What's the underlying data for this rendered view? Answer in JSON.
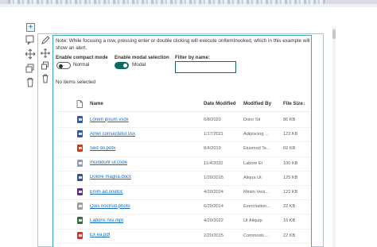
{
  "note": "Note: While focusing a row, pressing enter or double clicking will execute onItemInvoked, which in this example will show an alert.",
  "controls": {
    "compact_label": "Enable compact mode",
    "compact_value": "Normal",
    "modal_label": "Enable modal selection",
    "modal_value": "Modal",
    "filter_label": "Filter by name:",
    "filter_value": ""
  },
  "selection_text": "No items selected",
  "columns": {
    "name": "Name",
    "date": "Date Modified",
    "by": "Modified By",
    "size": "File Size",
    "sort_indicator": "↓"
  },
  "rows": [
    {
      "name": "Lorem ipsum.vsdx",
      "date": "6/8/2020",
      "by": "Dolor Sit",
      "size": "86 KB",
      "type_icon": "visio-file-icon",
      "color": "#3955a3"
    },
    {
      "name": "Amet consectetur.vsx",
      "date": "1/17/2021",
      "by": "Adipiscing ...",
      "size": "122 KB",
      "type_icon": "visio-file-icon",
      "color": "#3955a3"
    },
    {
      "name": "Sed do.potx",
      "date": "8/4/2019",
      "by": "Eiusmod Te...",
      "size": "69 KB",
      "type_icon": "powerpoint-file-icon",
      "color": "#c43e1c"
    },
    {
      "name": "Incididunt ut.code",
      "date": "11/4/2020",
      "by": "Labore Et",
      "size": "100 KB",
      "type_icon": "code-file-icon",
      "color": "#8aa0b8"
    },
    {
      "name": "Dolore magna.docx",
      "date": "1/20/2015",
      "by": "Aliqua Ut",
      "size": "125 KB",
      "type_icon": "word-file-icon",
      "color": "#2b579a"
    },
    {
      "name": "Enim ad.onetoc",
      "date": "4/20/2024",
      "by": "Minim Veni...",
      "size": "122 KB",
      "type_icon": "onenote-file-icon",
      "color": "#7719aa"
    },
    {
      "name": "Quis nostrud.photo",
      "date": "6/20/2014",
      "by": "Exercitation...",
      "size": "22 KB",
      "type_icon": "photo-file-icon",
      "color": "#9e9e9e"
    },
    {
      "name": "Laboris nisi.mpt",
      "date": "4/20/2022",
      "by": "Ut Aliquip",
      "size": "16 KB",
      "type_icon": "project-file-icon",
      "color": "#31752f"
    },
    {
      "name": "Ex ea.pdf",
      "date": "2/20/2015",
      "by": "Commodo ...",
      "size": "22 KB",
      "type_icon": "pdf-file-icon",
      "color": "#d13438"
    }
  ]
}
